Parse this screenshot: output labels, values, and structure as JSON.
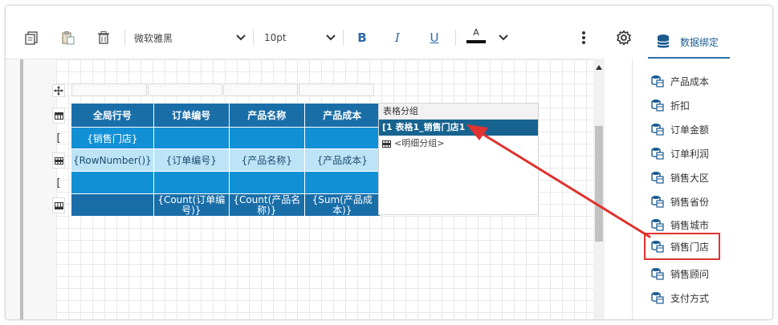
{
  "toolbar": {
    "font_family": "微软雅黑",
    "font_size": "10pt",
    "bold": "B",
    "italic": "I",
    "underline": "U",
    "font_color_glyph": "A",
    "data_binding_tab": "数据绑定"
  },
  "table": {
    "header": [
      "全局行号",
      "订单编号",
      "产品名称",
      "产品成本"
    ],
    "group_row": [
      "{销售门店}",
      "",
      "",
      ""
    ],
    "detail_row": [
      "{RowNumber()}",
      "{订单编号}",
      "{产品名称}",
      "{产品成本}"
    ],
    "footer_row": [
      "",
      "{Count(订单编号)}",
      "{Count(产品名称)}",
      "{Sum(产品成本)}"
    ],
    "row_handle_glyph": "["
  },
  "grouping": {
    "title": "表格分组",
    "selected": "[1 表格1_销售门店1",
    "detail": "<明细分组>"
  },
  "fields": [
    "产品成本",
    "折扣",
    "订单金额",
    "订单利润",
    "销售大区",
    "销售省份",
    "销售城市",
    "销售门店",
    "销售顾问",
    "支付方式"
  ],
  "colors": {
    "header_bg": "#1a6ea8",
    "group_bg": "#1290d6",
    "detail_bg": "#bde3f7",
    "selected_group_bg": "#17638f",
    "highlight": "#e0322f"
  }
}
